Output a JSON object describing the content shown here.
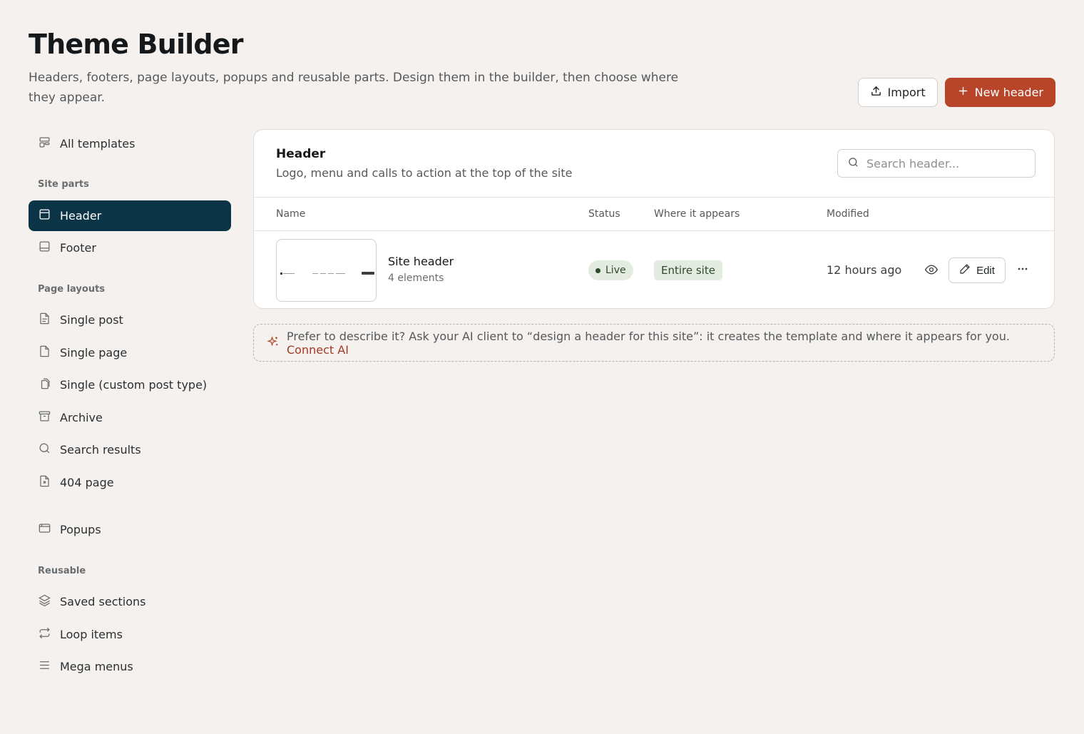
{
  "page": {
    "title": "Theme Builder",
    "description": "Headers, footers, page layouts, popups and reusable parts. Design them in the builder, then choose where they appear."
  },
  "actions": {
    "import_label": "Import",
    "new_label": "New header"
  },
  "sidebar": {
    "all_templates": "All templates",
    "sections": {
      "site_parts": "Site parts",
      "page_layouts": "Page layouts",
      "reusable": "Reusable"
    },
    "items": {
      "header": "Header",
      "footer": "Footer",
      "single_post": "Single post",
      "single_page": "Single page",
      "single_cpt": "Single (custom post type)",
      "archive": "Archive",
      "search_results": "Search results",
      "page_404": "404 page",
      "popups": "Popups",
      "saved_sections": "Saved sections",
      "loop_items": "Loop items",
      "mega_menus": "Mega menus"
    }
  },
  "card": {
    "title": "Header",
    "subtitle": "Logo, menu and calls to action at the top of the site",
    "search_placeholder": "Search header...",
    "columns": {
      "name": "Name",
      "status": "Status",
      "where": "Where it appears",
      "modified": "Modified"
    },
    "rows": [
      {
        "name": "Site header",
        "meta": "4 elements",
        "status": "Live",
        "where": "Entire site",
        "modified": "12 hours ago",
        "edit_label": "Edit"
      }
    ]
  },
  "ai_prompt": {
    "text": "Prefer to describe it? Ask your AI client to “design a header for this site”: it creates the template and where it appears for you.",
    "link": "Connect AI"
  },
  "colors": {
    "background": "#f4f1ee",
    "active_nav": "#0c3447",
    "primary": "#b8442a",
    "live_badge": "#e4ebe1"
  }
}
